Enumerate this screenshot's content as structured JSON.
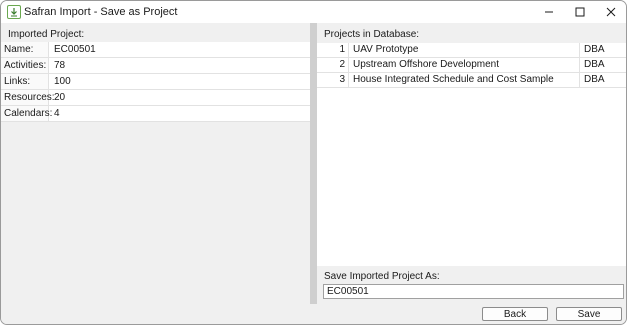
{
  "window": {
    "title": "Safran Import - Save as Project",
    "icon": "import-arrow-icon"
  },
  "left": {
    "heading": "Imported Project:",
    "properties": [
      {
        "key": "Name:",
        "value": "EC00501"
      },
      {
        "key": "Activities:",
        "value": "78"
      },
      {
        "key": "Links:",
        "value": "100"
      },
      {
        "key": "Resources:",
        "value": "20"
      },
      {
        "key": "Calendars:",
        "value": "4"
      }
    ]
  },
  "right": {
    "heading": "Projects in Database:",
    "projects": [
      {
        "num": "1",
        "name": "UAV Prototype",
        "owner": "DBA"
      },
      {
        "num": "2",
        "name": "Upstream Offshore Development",
        "owner": "DBA"
      },
      {
        "num": "3",
        "name": "House Integrated Schedule and Cost Sample",
        "owner": "DBA"
      }
    ],
    "save_label": "Save Imported Project As:",
    "save_value": "EC00501"
  },
  "buttons": {
    "back": "Back",
    "save": "Save"
  },
  "colors": {
    "accent_icon": "#6aa84f",
    "splitter": "#cfcfcf",
    "panel_bg": "#f0f0f0"
  }
}
